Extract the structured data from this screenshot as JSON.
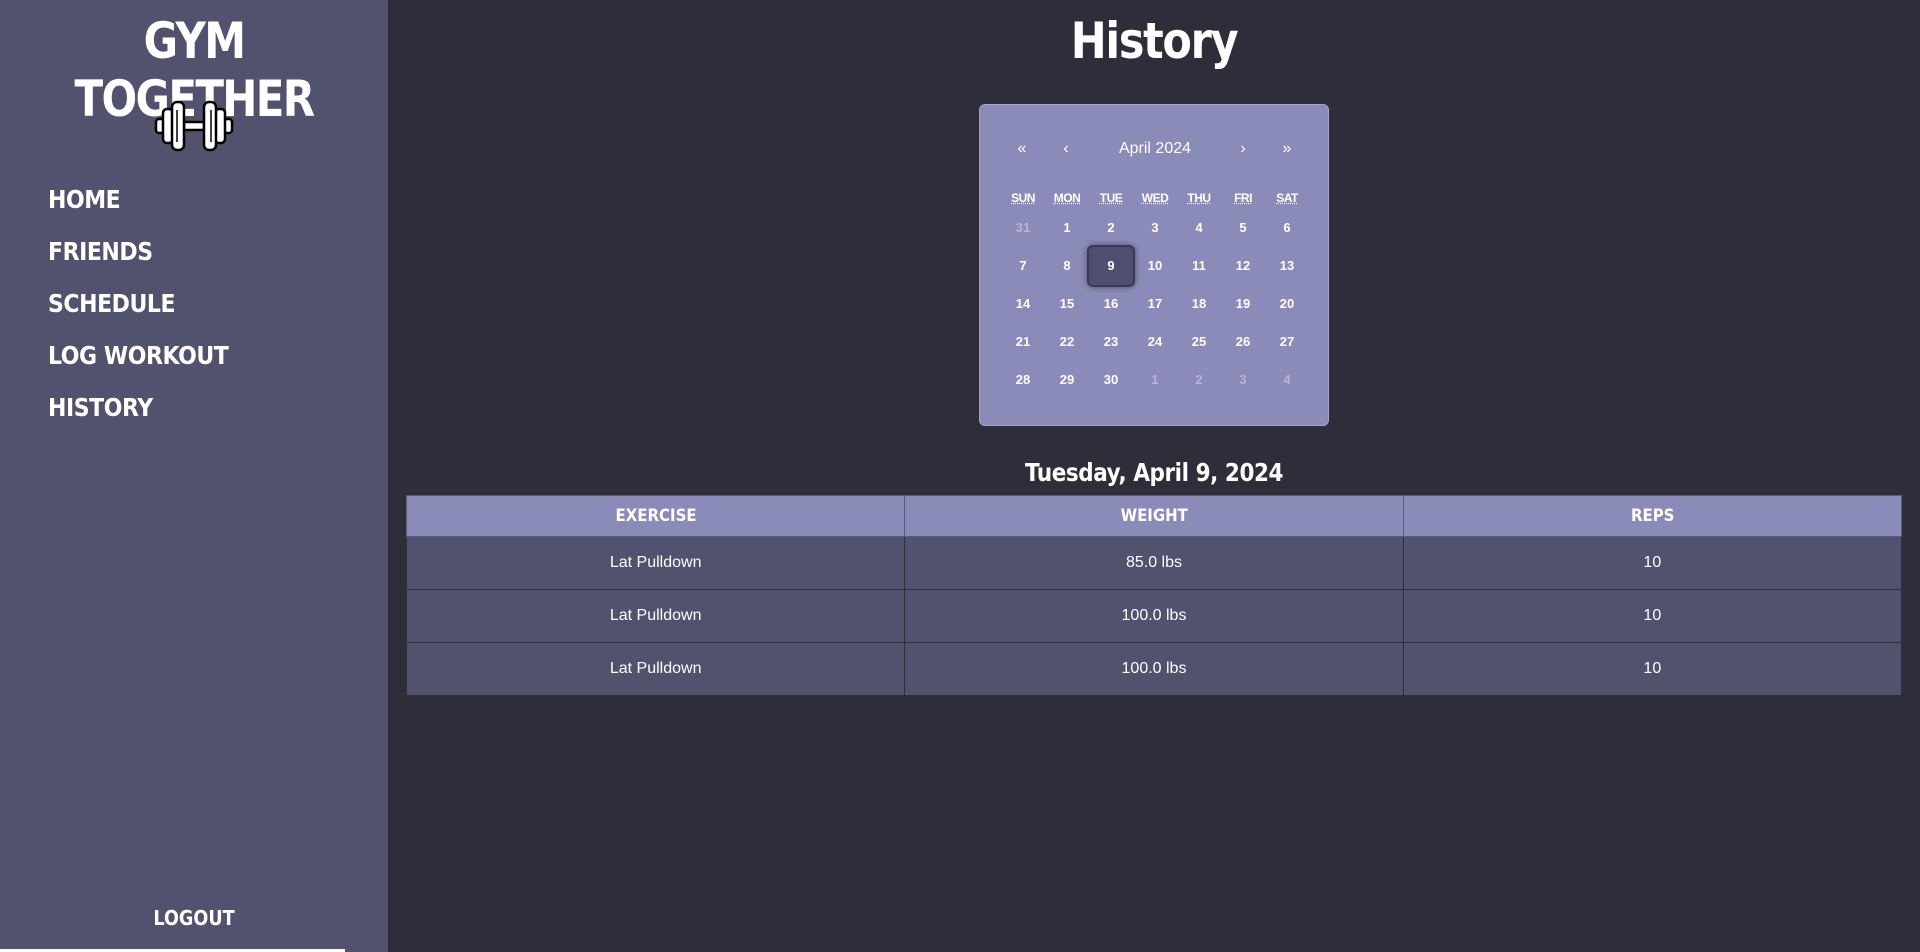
{
  "sidebar": {
    "brand": "GYM TOGETHER",
    "logo_icon": "dumbbell-icon",
    "items": [
      {
        "label": "HOME"
      },
      {
        "label": "FRIENDS"
      },
      {
        "label": "SCHEDULE"
      },
      {
        "label": "LOG WORKOUT"
      },
      {
        "label": "HISTORY"
      }
    ],
    "logout": "LOGOUT"
  },
  "page": {
    "title": "History"
  },
  "calendar": {
    "prev_year": "«",
    "prev_month": "‹",
    "month_label": "April 2024",
    "next_month": "›",
    "next_year": "»",
    "weekdays": [
      "SUN",
      "MON",
      "TUE",
      "WED",
      "THU",
      "FRI",
      "SAT"
    ],
    "weeks": [
      [
        "31",
        "1",
        "2",
        "3",
        "4",
        "5",
        "6"
      ],
      [
        "7",
        "8",
        "9",
        "10",
        "11",
        "12",
        "13"
      ],
      [
        "14",
        "15",
        "16",
        "17",
        "18",
        "19",
        "20"
      ],
      [
        "21",
        "22",
        "23",
        "24",
        "25",
        "26",
        "27"
      ],
      [
        "28",
        "29",
        "30",
        "1",
        "2",
        "3",
        "4"
      ]
    ],
    "selected": "9"
  },
  "history": {
    "date_heading": "Tuesday, April 9, 2024",
    "columns": [
      "EXERCISE",
      "WEIGHT",
      "REPS"
    ],
    "rows": [
      [
        "Lat Pulldown",
        "85.0 lbs",
        "10"
      ],
      [
        "Lat Pulldown",
        "100.0 lbs",
        "10"
      ],
      [
        "Lat Pulldown",
        "100.0 lbs",
        "10"
      ]
    ]
  },
  "colors": {
    "background": "#2e2d3a",
    "sidebar": "#52526e",
    "accent": "#8a8bb8"
  }
}
